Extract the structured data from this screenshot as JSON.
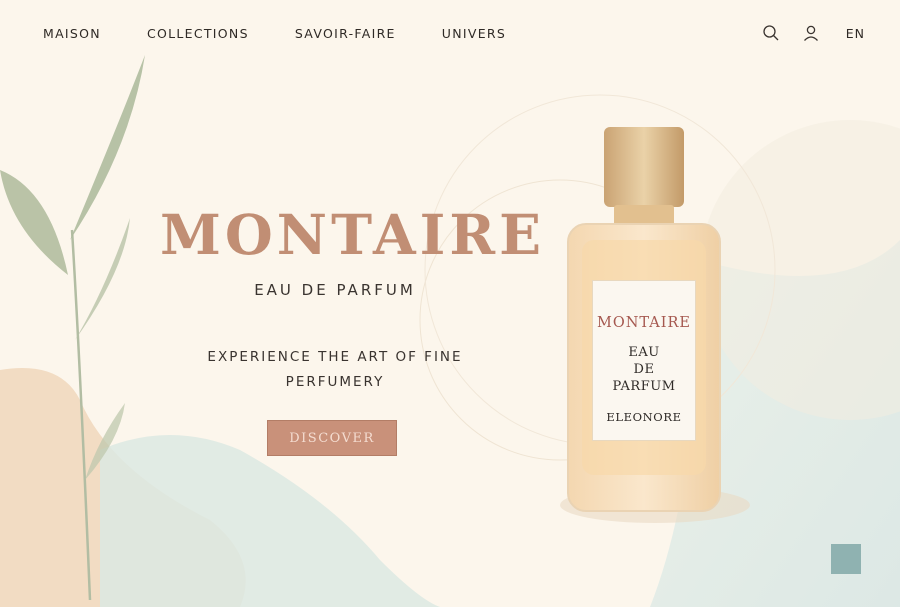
{
  "nav": {
    "items": [
      {
        "label": "MAISON"
      },
      {
        "label": "COLLECTIONS"
      },
      {
        "label": "SAVOIR-FAIRE"
      },
      {
        "label": "UNIVERS"
      }
    ]
  },
  "utility": {
    "icons": [
      "search-icon",
      "user-icon"
    ],
    "language": "EN"
  },
  "hero": {
    "brand": "MONTAIRE",
    "subtitle": "EAU DE PARFUM",
    "tagline_line1": "EXPERIENCE THE ART OF FINE",
    "tagline_line2": "PERFUMERY",
    "cta_label": "DISCOVER"
  },
  "bottle_label": {
    "brand": "MONTAIRE",
    "line1": "EAU",
    "line2": "DE",
    "line3": "PARFUM",
    "name": "ELEONORE"
  },
  "colors": {
    "background": "#fcf6ec",
    "accent": "#c18e74",
    "button": "#c9917a",
    "gold": "#e9c98e",
    "swatch": "#8fb2b1"
  }
}
